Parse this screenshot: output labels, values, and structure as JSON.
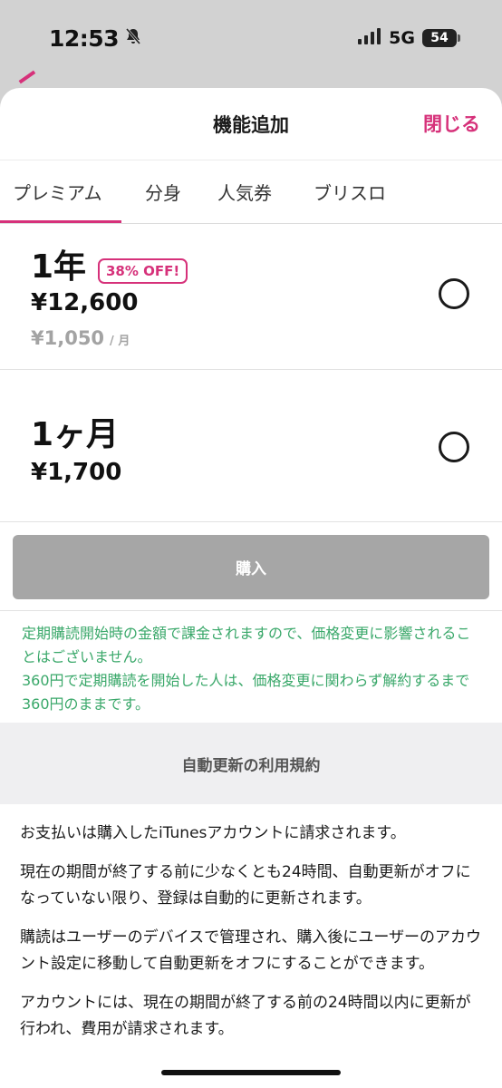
{
  "status_bar": {
    "time": "12:53",
    "network": "5G",
    "battery": "54"
  },
  "header": {
    "title": "機能追加",
    "close_label": "閉じる"
  },
  "tabs": [
    {
      "label": "プレミアム",
      "active": true
    },
    {
      "label": "分身",
      "active": false
    },
    {
      "label": "人気券",
      "active": false
    },
    {
      "label": "ブリスロ",
      "active": false
    }
  ],
  "plans": [
    {
      "name": "1年",
      "badge": "38% OFF!",
      "price": "¥12,600",
      "monthly_price": "¥1,050",
      "monthly_unit": "/ 月",
      "selected": false
    },
    {
      "name": "1ヶ月",
      "price": "¥1,700",
      "selected": false
    }
  ],
  "purchase": {
    "label": "購入"
  },
  "notice": {
    "line1": "定期購読開始時の金額で課金されますので、価格変更に影響されることはございません。",
    "line2": "360円で定期購読を開始した人は、価格変更に関わらず解約するまで360円のままです。"
  },
  "terms": {
    "title": "自動更新の利用規約",
    "paragraphs": [
      "お支払いは購入したiTunesアカウントに請求されます。",
      "現在の期間が終了する前に少なくとも24時間、自動更新がオフになっていない限り、登録は自動的に更新されます。",
      "購読はユーザーのデバイスで管理され、購入後にユーザーのアカウント設定に移動して自動更新をオフにすることができます。",
      "アカウントには、現在の期間が終了する前の24時間以内に更新が行われ、費用が請求されます。"
    ]
  },
  "colors": {
    "accent": "#d6317a",
    "notice": "#3aa86a",
    "disabled_button": "#a6a6a6"
  }
}
